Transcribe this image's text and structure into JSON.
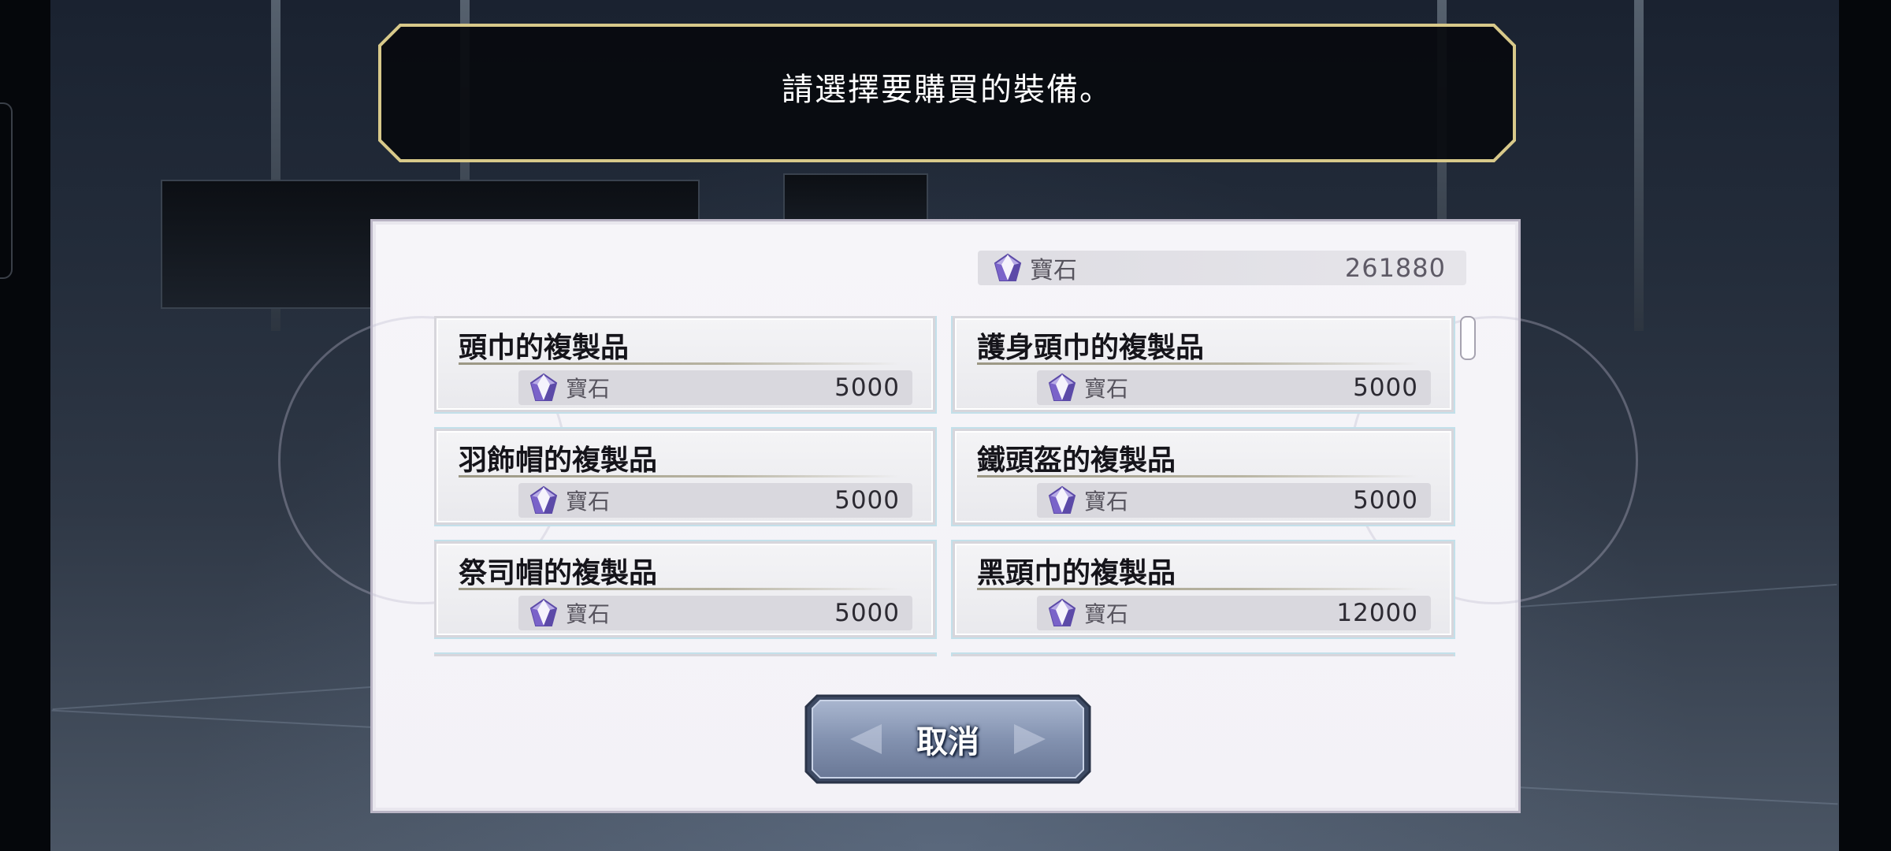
{
  "header": {
    "message": "請選擇要購買的裝備。"
  },
  "currency": {
    "icon": "gem-icon",
    "label": "寶石",
    "amount": "261880"
  },
  "items": [
    {
      "name": "頭巾的複製品",
      "currency_label": "寶石",
      "price": "5000"
    },
    {
      "name": "護身頭巾的複製品",
      "currency_label": "寶石",
      "price": "5000"
    },
    {
      "name": "羽飾帽的複製品",
      "currency_label": "寶石",
      "price": "5000"
    },
    {
      "name": "鐵頭盔的複製品",
      "currency_label": "寶石",
      "price": "5000"
    },
    {
      "name": "祭司帽的複製品",
      "currency_label": "寶石",
      "price": "5000"
    },
    {
      "name": "黑頭巾的複製品",
      "currency_label": "寶石",
      "price": "12000"
    }
  ],
  "scrollbar": {
    "scroll_position": 0
  },
  "cancel_button": {
    "label": "取消"
  },
  "colors": {
    "frame_gold": "#d8c98a",
    "panel_bg": "#f4f3f8",
    "card_glow": "#c3e0ea",
    "gem_purple": "#7a63c9"
  }
}
